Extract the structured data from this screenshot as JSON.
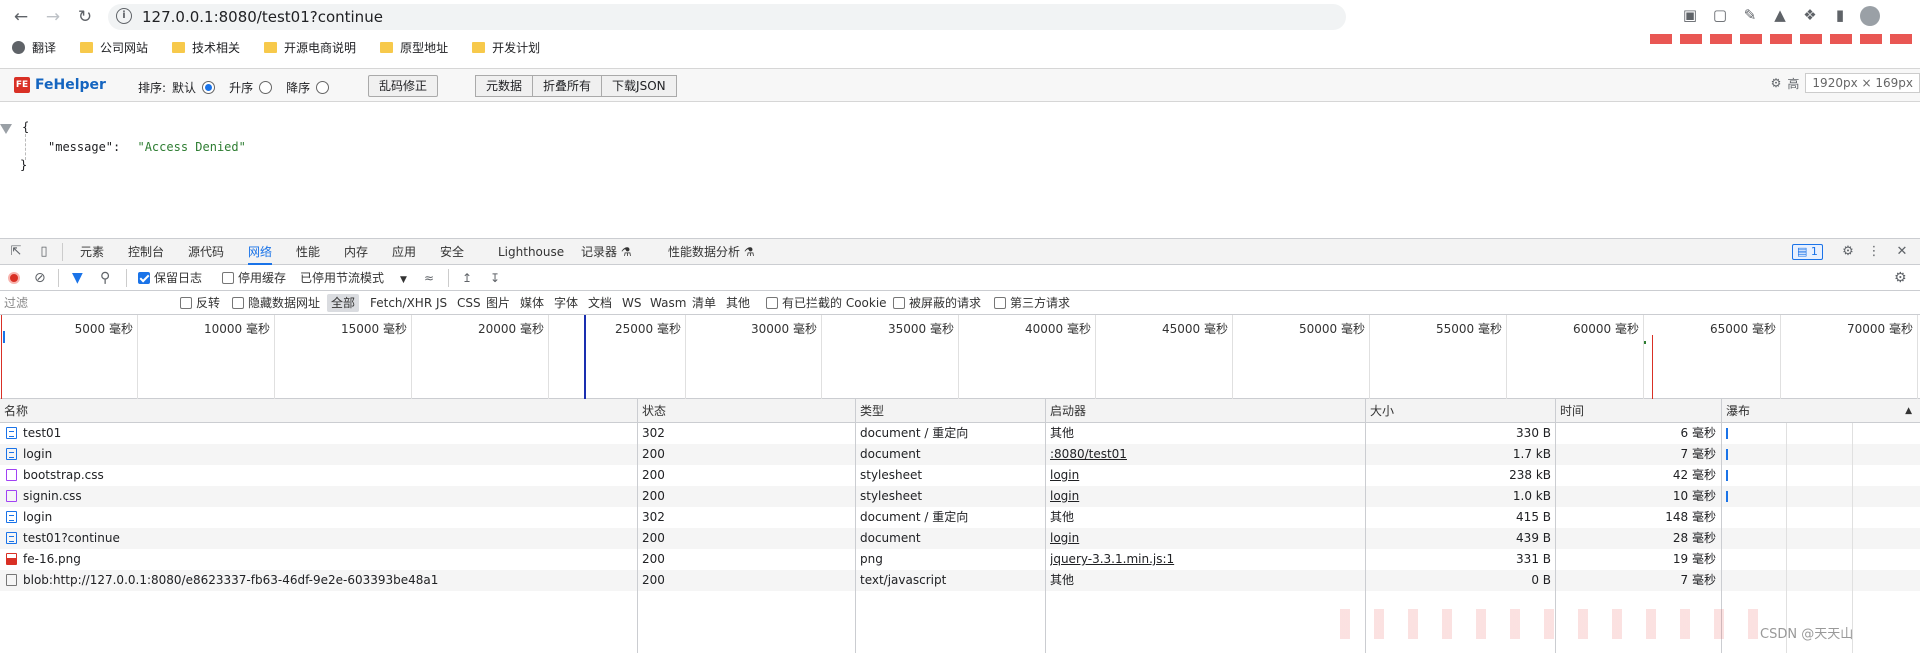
{
  "browser": {
    "url": "127.0.0.1:8080/test01?continue",
    "bookmarks": [
      {
        "label": "翻译",
        "icon": "globe-icon"
      },
      {
        "label": "公司网站",
        "icon": "folder-icon"
      },
      {
        "label": "技术相关",
        "icon": "folder-icon"
      },
      {
        "label": "开源电商说明",
        "icon": "folder-icon"
      },
      {
        "label": "原型地址",
        "icon": "folder-icon"
      },
      {
        "label": "开发计划",
        "icon": "folder-icon"
      }
    ]
  },
  "fehelper": {
    "logo_badge": "FE",
    "logo": "FeHelper",
    "sort_label": "排序:",
    "sort_default": "默认",
    "sort_asc": "升序",
    "sort_desc": "降序",
    "fix_encoding": "乱码修正",
    "raw": "元数据",
    "collapse_all": "折叠所有",
    "download_json": "下载JSON",
    "high": "高",
    "dimensions": "1920px × 169px"
  },
  "json_view": {
    "open_brace": "{",
    "key": "\"message\":",
    "value": "\"Access Denied\"",
    "close_brace": "}"
  },
  "devtools": {
    "tabs": [
      "元素",
      "控制台",
      "源代码",
      "网络",
      "性能",
      "内存",
      "应用",
      "安全",
      "Lighthouse",
      "记录器 ⚗",
      "性能数据分析 ⚗"
    ],
    "active_tab": "网络",
    "message_count": "1",
    "toolbar": {
      "preserve_log": "保留日志",
      "disable_cache": "停用缓存",
      "throttle": "已停用节流模式"
    },
    "filter": {
      "placeholder": "过滤",
      "invert": "反转",
      "hide_data_urls": "隐藏数据网址",
      "types": [
        "全部",
        "Fetch/XHR",
        "JS",
        "CSS",
        "图片",
        "媒体",
        "字体",
        "文档",
        "WS",
        "Wasm",
        "清单",
        "其他"
      ],
      "blocked_cookies": "有已拦截的 Cookie",
      "blocked_requests": "被屏蔽的请求",
      "third_party": "第三方请求"
    },
    "overview_ticks": [
      "5000 毫秒",
      "10000 毫秒",
      "15000 毫秒",
      "20000 毫秒",
      "25000 毫秒",
      "30000 毫秒",
      "35000 毫秒",
      "40000 毫秒",
      "45000 毫秒",
      "50000 毫秒",
      "55000 毫秒",
      "60000 毫秒",
      "65000 毫秒",
      "70000 毫秒"
    ],
    "columns": {
      "name": "名称",
      "status": "状态",
      "type": "类型",
      "initiator": "启动器",
      "size": "大小",
      "time": "时间",
      "waterfall": "瀑布"
    },
    "requests": [
      {
        "name": "test01",
        "status": "302",
        "type": "document / 重定向",
        "initiator": "其他",
        "initiator_link": false,
        "size": "330 B",
        "time": "6 毫秒",
        "icon": "doc"
      },
      {
        "name": "login",
        "status": "200",
        "type": "document",
        "initiator": ":8080/test01",
        "initiator_link": true,
        "size": "1.7 kB",
        "time": "7 毫秒",
        "icon": "doc"
      },
      {
        "name": "bootstrap.css",
        "status": "200",
        "type": "stylesheet",
        "initiator": "login",
        "initiator_link": true,
        "size": "238 kB",
        "time": "42 毫秒",
        "icon": "css"
      },
      {
        "name": "signin.css",
        "status": "200",
        "type": "stylesheet",
        "initiator": "login",
        "initiator_link": true,
        "size": "1.0 kB",
        "time": "10 毫秒",
        "icon": "css"
      },
      {
        "name": "login",
        "status": "302",
        "type": "document / 重定向",
        "initiator": "其他",
        "initiator_link": false,
        "size": "415 B",
        "time": "148 毫秒",
        "icon": "doc"
      },
      {
        "name": "test01?continue",
        "status": "200",
        "type": "document",
        "initiator": "login",
        "initiator_link": true,
        "size": "439 B",
        "time": "28 毫秒",
        "icon": "doc"
      },
      {
        "name": "fe-16.png",
        "status": "200",
        "type": "png",
        "initiator": "jquery-3.3.1.min.js:1",
        "initiator_link": true,
        "size": "331 B",
        "time": "19 毫秒",
        "icon": "png"
      },
      {
        "name": "blob:http://127.0.0.1:8080/e8623337-fb63-46df-9e2e-603393be48a1",
        "status": "200",
        "type": "text/javascript",
        "initiator": "其他",
        "initiator_link": false,
        "size": "0 B",
        "time": "7 毫秒",
        "icon": "blob"
      }
    ],
    "watermark": "CSDN @天天山"
  }
}
